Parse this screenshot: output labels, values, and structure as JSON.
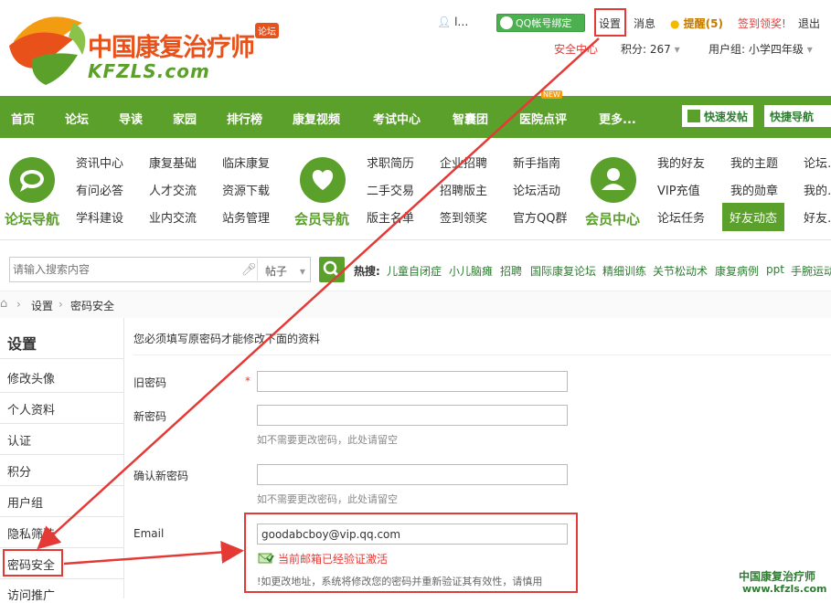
{
  "header": {
    "logo_cn": "中国康复治疗师",
    "logo_en": "KFZLS.com",
    "logo_badge": "论坛",
    "username": "l…",
    "qq_bind": "QQ帐号绑定",
    "settings": "设置",
    "messages": "消息",
    "reminders": "提醒(5)",
    "checkin": "签到领奖!",
    "logout": "退出",
    "security_center": "安全中心",
    "points": "积分: 267",
    "user_group": "用户组: 小学四年级"
  },
  "nav": {
    "items": [
      "首页",
      "论坛",
      "导读",
      "家园",
      "排行榜",
      "康复视频",
      "考试中心",
      "智囊团",
      "医院点评",
      "更多..."
    ],
    "new_badge": "NEW",
    "quick_post": "快速发帖",
    "quick_nav": "快捷导航"
  },
  "subnav": {
    "forum_title": "论坛导航",
    "forum_links": [
      "资讯中心",
      "康复基础",
      "临床康复",
      "有问必答",
      "人才交流",
      "资源下载",
      "学科建设",
      "业内交流",
      "站务管理"
    ],
    "member_title": "会员导航",
    "member_links": [
      "求职简历",
      "企业招聘",
      "新手指南",
      "二手交易",
      "招聘版主",
      "论坛活动",
      "版主名单",
      "签到领奖",
      "官方QQ群"
    ],
    "center_title": "会员中心",
    "center_links": [
      "我的好友",
      "我的主题",
      "论坛…",
      "VIP充值",
      "我的勋章",
      "我的…",
      "论坛任务",
      "好友动态",
      "好友…"
    ]
  },
  "search": {
    "placeholder": "请输入搜索内容",
    "scope": "帖子",
    "hot_label": "热搜:",
    "hot_terms": [
      "儿童自闭症",
      "小儿脑瘫",
      "招聘",
      "国际康复论坛",
      "精细训练",
      "关节松动术",
      "康复病例",
      "ppt",
      "手腕运动"
    ]
  },
  "breadcrumb": {
    "items": [
      "设置",
      "密码安全"
    ]
  },
  "sidebar": {
    "title": "设置",
    "items": [
      "修改头像",
      "个人资料",
      "认证",
      "积分",
      "用户组",
      "隐私筛选",
      "密码安全",
      "访问推广"
    ]
  },
  "form": {
    "intro": "您必须填写原密码才能修改下面的资料",
    "old_password_label": "旧密码",
    "required_mark": "*",
    "new_password_label": "新密码",
    "new_password_hint": "如不需要更改密码，此处请留空",
    "confirm_label": "确认新密码",
    "confirm_hint": "如不需要更改密码，此处请留空",
    "email_label": "Email",
    "email_value": "goodabcboy@vip.qq.com",
    "email_status": "当前邮箱已经验证激活",
    "email_warning": "!如更改地址，系统将修改您的密码并重新验证其有效性，请慎用"
  },
  "watermark": {
    "cn": "中国康复治疗师",
    "url": "www.kfzls.com"
  },
  "colors": {
    "brand_green": "#5ba02b",
    "brand_orange": "#e8521a",
    "annotation_red": "#e53935"
  }
}
